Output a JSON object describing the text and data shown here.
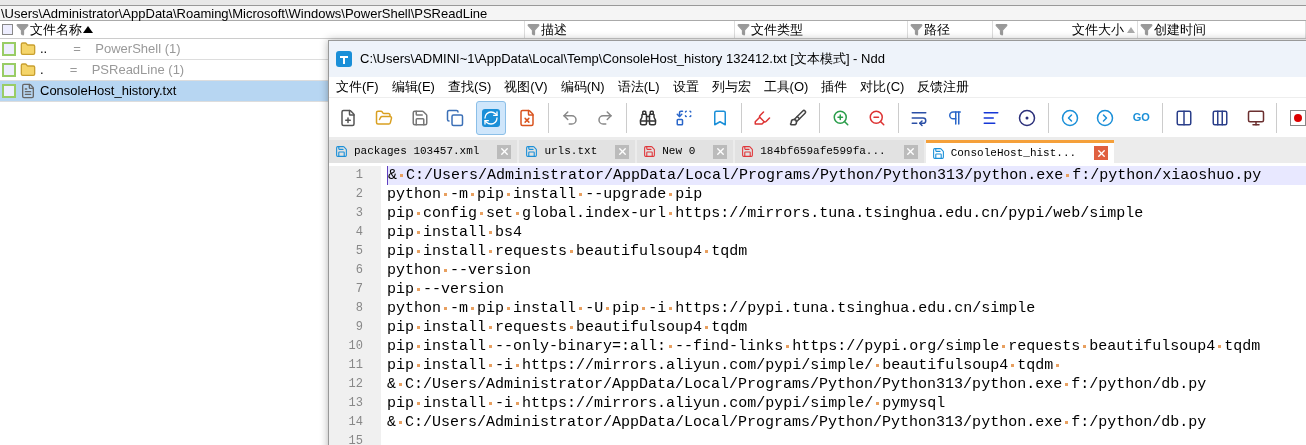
{
  "explorer": {
    "path": "\\Users\\Administrator\\AppData\\Roaming\\Microsoft\\Windows\\PowerShell\\PSReadLine",
    "all_checked": false,
    "columns": [
      {
        "label": "文件名称",
        "sorted": true,
        "secondary": false
      },
      {
        "label": "描述",
        "sorted": false
      },
      {
        "label": "文件类型",
        "sorted": false
      },
      {
        "label": "路径",
        "sorted": false
      },
      {
        "label": "文件大小",
        "sorted": true,
        "secondary": true
      },
      {
        "label": "创建时间",
        "sorted": false
      }
    ],
    "rows": [
      {
        "kind": "folder",
        "name": "..",
        "separator": "=",
        "link": "PowerShell",
        "count": "(1)",
        "checked": false,
        "selected": false
      },
      {
        "kind": "folder",
        "name": ".",
        "separator": "=",
        "link": "PSReadLine",
        "count": "(1)",
        "checked": false,
        "selected": false
      },
      {
        "kind": "file",
        "name": "ConsoleHost_history.txt",
        "checked": false,
        "selected": true
      }
    ]
  },
  "editor": {
    "title": "C:\\Users\\ADMINI~1\\AppData\\Local\\Temp\\ConsoleHost_history 132412.txt [文本模式] - Ndd",
    "menu": [
      "文件(F)",
      "编辑(E)",
      "查找(S)",
      "视图(V)",
      "编码(N)",
      "语法(L)",
      "设置",
      "列与宏",
      "工具(O)",
      "插件",
      "对比(C)",
      "反馈注册"
    ],
    "toolbar": [
      {
        "selected": false
      },
      {
        "selected": false
      },
      {
        "selected": false
      },
      {
        "selected": false
      },
      {
        "selected": true
      },
      {
        "selected": false
      },
      {
        "selected": false
      },
      {
        "selected": false
      },
      {
        "selected": false
      },
      {
        "selected": false
      },
      {
        "selected": false
      },
      {
        "selected": false
      },
      {
        "selected": false
      },
      {
        "selected": false
      },
      {
        "selected": false
      },
      {
        "selected": false
      },
      {
        "selected": false
      },
      {
        "selected": false
      },
      {
        "selected": false
      },
      {
        "selected": false
      },
      {
        "selected": false
      },
      {
        "selected": false,
        "label": "GO"
      },
      {
        "selected": false
      },
      {
        "selected": false
      },
      {
        "selected": false
      },
      {
        "selected": false
      }
    ],
    "tabs": [
      {
        "label": "packages 103457.xml",
        "modified": false,
        "selected": false
      },
      {
        "label": "urls.txt",
        "modified": false,
        "selected": false
      },
      {
        "label": "New 0",
        "modified": true,
        "selected": false
      },
      {
        "label": "184bf659afe599fa...",
        "modified": true,
        "selected": false
      },
      {
        "label": "ConsoleHost_hist...",
        "modified": false,
        "selected": true
      }
    ],
    "lines": [
      {
        "number": "1",
        "text": "& C:/Users/Administrator/AppData/Local/Programs/Python/Python313/python.exe f:/python/xiaoshuo.py",
        "current": true
      },
      {
        "number": "2",
        "text": "python -m pip install --upgrade pip",
        "current": false
      },
      {
        "number": "3",
        "text": "pip config set global.index-url https://mirrors.tuna.tsinghua.edu.cn/pypi/web/simple",
        "current": false
      },
      {
        "number": "4",
        "text": "pip install bs4",
        "current": false
      },
      {
        "number": "5",
        "text": "pip install requests beautifulsoup4 tqdm",
        "current": false
      },
      {
        "number": "6",
        "text": "python --version",
        "current": false
      },
      {
        "number": "7",
        "text": "pip --version",
        "current": false
      },
      {
        "number": "8",
        "text": "python -m pip install -U pip -i https://pypi.tuna.tsinghua.edu.cn/simple",
        "current": false
      },
      {
        "number": "9",
        "text": "pip install requests beautifulsoup4 tqdm",
        "current": false
      },
      {
        "number": "10",
        "text": "pip install --only-binary=:all: --find-links https://pypi.org/simple requests beautifulsoup4 tqdm",
        "current": false
      },
      {
        "number": "11",
        "text": "pip install -i https://mirrors.aliyun.com/pypi/simple/ beautifulsoup4 tqdm ",
        "current": false
      },
      {
        "number": "12",
        "text": "& C:/Users/Administrator/AppData/Local/Programs/Python/Python313/python.exe f:/python/db.py",
        "current": false
      },
      {
        "number": "13",
        "text": "pip install -i https://mirrors.aliyun.com/pypi/simple/ pymysql",
        "current": false
      },
      {
        "number": "14",
        "text": "& C:/Users/Administrator/AppData/Local/Programs/Python/Python313/python.exe f:/python/db.py",
        "current": false
      },
      {
        "number": "15",
        "current": false
      }
    ]
  }
}
